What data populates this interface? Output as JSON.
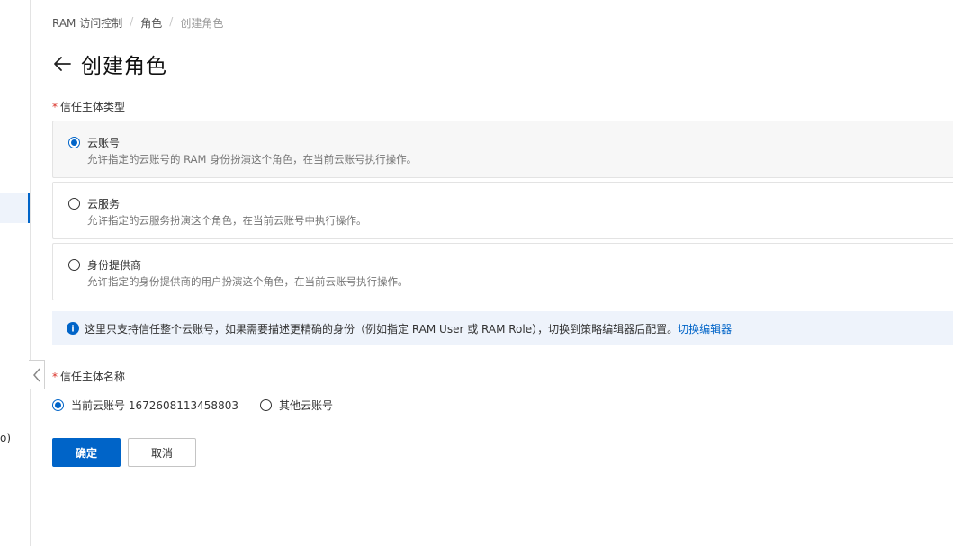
{
  "sidebar": {
    "snippet": "o)"
  },
  "breadcrumb": {
    "items": [
      "RAM 访问控制",
      "角色",
      "创建角色"
    ],
    "separator": "/"
  },
  "page": {
    "title": "创建角色"
  },
  "principal_type": {
    "label": "信任主体类型",
    "required_mark": "*",
    "options": [
      {
        "title": "云账号",
        "desc": "允许指定的云账号的 RAM 身份扮演这个角色，在当前云账号执行操作。",
        "selected": true
      },
      {
        "title": "云服务",
        "desc": "允许指定的云服务扮演这个角色，在当前云账号中执行操作。",
        "selected": false
      },
      {
        "title": "身份提供商",
        "desc": "允许指定的身份提供商的用户扮演这个角色，在当前云账号执行操作。",
        "selected": false
      }
    ]
  },
  "notice": {
    "text": "这里只支持信任整个云账号，如果需要描述更精确的身份（例如指定 RAM User 或 RAM Role），切换到策略编辑器后配置。",
    "link": "切换编辑器"
  },
  "principal_name": {
    "label": "信任主体名称",
    "required_mark": "*",
    "options": [
      {
        "label": "当前云账号 1672608113458803",
        "selected": true
      },
      {
        "label": "其他云账号",
        "selected": false
      }
    ]
  },
  "actions": {
    "confirm": "确定",
    "cancel": "取消"
  },
  "colors": {
    "primary": "#0064c8",
    "required": "#d93026",
    "notice_bg": "#eef3fb"
  }
}
